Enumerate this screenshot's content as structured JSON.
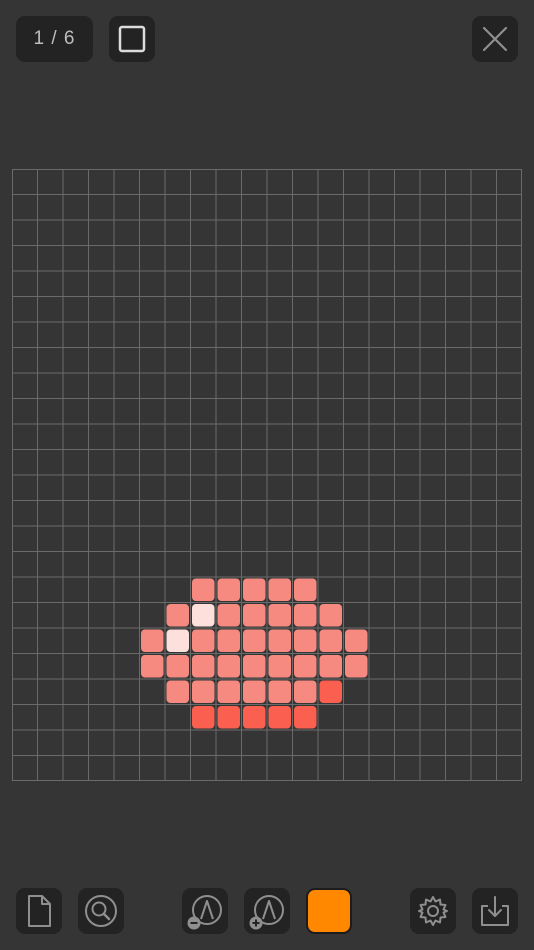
{
  "header": {
    "page_indicator": "1 / 6",
    "square_icon": "square-outline-icon",
    "close_icon": "close-icon"
  },
  "canvas": {
    "columns": 20,
    "rows": 24,
    "line_color": "#6a6a6a",
    "cell_corner_style": "rounded",
    "pixels": [
      {
        "row": 16,
        "col": 7,
        "color": "#f78a80"
      },
      {
        "row": 16,
        "col": 8,
        "color": "#f78a80"
      },
      {
        "row": 16,
        "col": 9,
        "color": "#f78a80"
      },
      {
        "row": 16,
        "col": 10,
        "color": "#f78a80"
      },
      {
        "row": 16,
        "col": 11,
        "color": "#f78a80"
      },
      {
        "row": 17,
        "col": 6,
        "color": "#f78a80"
      },
      {
        "row": 17,
        "col": 7,
        "color": "#fde0dc"
      },
      {
        "row": 17,
        "col": 8,
        "color": "#f78a80"
      },
      {
        "row": 17,
        "col": 9,
        "color": "#f78a80"
      },
      {
        "row": 17,
        "col": 10,
        "color": "#f78a80"
      },
      {
        "row": 17,
        "col": 11,
        "color": "#f78a80"
      },
      {
        "row": 17,
        "col": 12,
        "color": "#f78a80"
      },
      {
        "row": 18,
        "col": 5,
        "color": "#f78a80"
      },
      {
        "row": 18,
        "col": 6,
        "color": "#fde0dc"
      },
      {
        "row": 18,
        "col": 7,
        "color": "#f78a80"
      },
      {
        "row": 18,
        "col": 8,
        "color": "#f78a80"
      },
      {
        "row": 18,
        "col": 9,
        "color": "#f78a80"
      },
      {
        "row": 18,
        "col": 10,
        "color": "#f78a80"
      },
      {
        "row": 18,
        "col": 11,
        "color": "#f78a80"
      },
      {
        "row": 18,
        "col": 12,
        "color": "#f78a80"
      },
      {
        "row": 18,
        "col": 13,
        "color": "#f78a80"
      },
      {
        "row": 19,
        "col": 5,
        "color": "#f78a80"
      },
      {
        "row": 19,
        "col": 6,
        "color": "#f78a80"
      },
      {
        "row": 19,
        "col": 7,
        "color": "#f78a80"
      },
      {
        "row": 19,
        "col": 8,
        "color": "#f78a80"
      },
      {
        "row": 19,
        "col": 9,
        "color": "#f78a80"
      },
      {
        "row": 19,
        "col": 10,
        "color": "#f78a80"
      },
      {
        "row": 19,
        "col": 11,
        "color": "#f78a80"
      },
      {
        "row": 19,
        "col": 12,
        "color": "#f78a80"
      },
      {
        "row": 19,
        "col": 13,
        "color": "#f78a80"
      },
      {
        "row": 20,
        "col": 6,
        "color": "#f78a80"
      },
      {
        "row": 20,
        "col": 7,
        "color": "#f78a80"
      },
      {
        "row": 20,
        "col": 8,
        "color": "#f78a80"
      },
      {
        "row": 20,
        "col": 9,
        "color": "#f78a80"
      },
      {
        "row": 20,
        "col": 10,
        "color": "#f78a80"
      },
      {
        "row": 20,
        "col": 11,
        "color": "#f78a80"
      },
      {
        "row": 20,
        "col": 12,
        "color": "#fb5f4f"
      },
      {
        "row": 21,
        "col": 7,
        "color": "#fb5f4f"
      },
      {
        "row": 21,
        "col": 8,
        "color": "#fb5f4f"
      },
      {
        "row": 21,
        "col": 9,
        "color": "#fb5f4f"
      },
      {
        "row": 21,
        "col": 10,
        "color": "#fb5f4f"
      },
      {
        "row": 21,
        "col": 11,
        "color": "#fb5f4f"
      }
    ]
  },
  "toolbar": {
    "new_icon": "document-icon",
    "zoom_icon": "magnifier-icon",
    "undo_icon": "brush-minus-icon",
    "redo_icon": "brush-plus-icon",
    "current_color": "#ff8800",
    "settings_icon": "gear-icon",
    "export_icon": "download-icon"
  }
}
